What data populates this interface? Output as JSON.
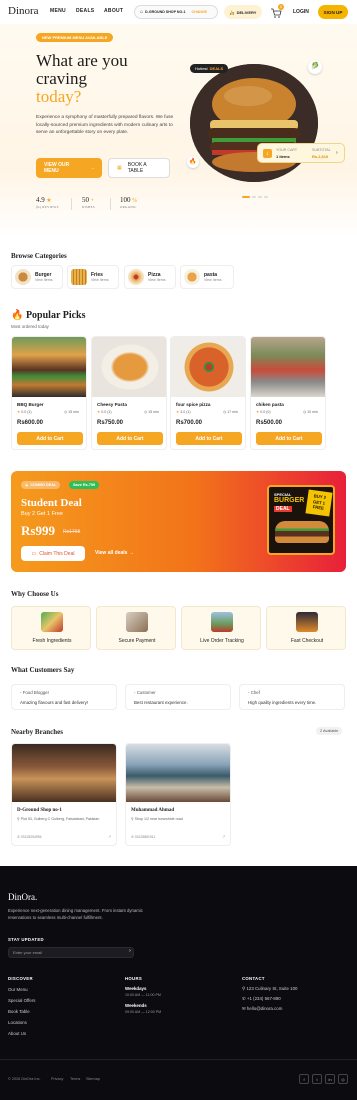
{
  "header": {
    "logo": "Dinora",
    "nav": [
      "MENU",
      "DEALS",
      "ABOUT"
    ],
    "shop": "D-GROUND SHOP NO-1",
    "shop_change": "CHANGE",
    "delivery": "DELIVERY",
    "cart_count": "0",
    "login": "LOGIN",
    "signup": "SIGN UP"
  },
  "hero": {
    "badge": "NEW PREMIUM MENU AVAILABLE",
    "title_line1": "What are you",
    "title_line2": "craving",
    "title_accent": "today?",
    "description": "Experience a symphony of masterfully prepared flavors. We fuse locally-sourced premium ingredients with modern culinary arts to serve an unforgettable story on every plate.",
    "primary_btn": "VIEW OUR MENU",
    "secondary_btn": "BOOK A TABLE",
    "stats": [
      {
        "value": "4.9",
        "label": "(K) REVIEWS"
      },
      {
        "value": "50",
        "label": "DISHES"
      },
      {
        "value": "100",
        "label": "ORGANIC"
      }
    ],
    "hot_tag": "Hottest",
    "hot_tag_accent": "DEALS",
    "cart": {
      "label": "YOUR CART",
      "items": "1 Items",
      "subtotal_label": "SUBTOTAL",
      "subtotal": "Rs.2,610"
    }
  },
  "categories": {
    "title": "Browse Categories",
    "items": [
      {
        "name": "Burger",
        "sub": "View Items"
      },
      {
        "name": "Fries",
        "sub": "View Items"
      },
      {
        "name": "Pizza",
        "sub": "View Items"
      },
      {
        "name": "pasta",
        "sub": "View Items"
      }
    ]
  },
  "popular": {
    "title": "Popular Picks",
    "subtitle": "Most ordered today",
    "add_label": "Add to Cart",
    "items": [
      {
        "name": "BBQ Burger",
        "rating": "0.0 (1)",
        "time": "15 min",
        "price": "Rs600.00"
      },
      {
        "name": "Cheesy Pasta",
        "rating": "0.0 (1)",
        "time": "15 min",
        "price": "Rs750.00"
      },
      {
        "name": "four spice pizza",
        "rating": "3.0 (1)",
        "time": "17 min",
        "price": "Rs700.00"
      },
      {
        "name": "chiken pasta",
        "rating": "0.0 (0)",
        "time": "10 min",
        "price": "Rs500.00"
      }
    ]
  },
  "combo": {
    "tag": "COMBO DEAL",
    "save": "Save Rs.799",
    "title": "Student Deal",
    "subtitle": "Buy 2 Get 1 Free",
    "price": "Rs999",
    "old_price": "Rs1798",
    "claim": "Claim This Deal",
    "view_all": "View all deals",
    "poster_line1": "SPECIAL",
    "poster_line2": "BURGER",
    "poster_line3": "DEAL",
    "poster_buy": "BUY 2",
    "poster_get": "GET 1",
    "poster_free": "FREE"
  },
  "why": {
    "title": "Why Choose Us",
    "items": [
      "Fresh Ingredients",
      "Secure Payment",
      "Live Order Tracking",
      "Fast Checkout"
    ]
  },
  "testimonials": {
    "title": "What Customers Say",
    "items": [
      {
        "role": "Food Blogger",
        "quote": "Amazing flavours and fast delivery!"
      },
      {
        "role": "Customer",
        "quote": "Best restaurant experience."
      },
      {
        "role": "Chef",
        "quote": "High quality ingredients every time."
      }
    ]
  },
  "branches": {
    "title": "Nearby Branches",
    "count": "2 Available",
    "items": [
      {
        "name": "D-Ground Shop no-1",
        "address": "Plot 53, Gulberg C Gulberg, Faisalabad, Pakistan",
        "phone": "03125254994"
      },
      {
        "name": "Muhammad Ahmad",
        "address": "Shop 1/2 near boseshide road",
        "phone": "03125881911"
      }
    ]
  },
  "footer": {
    "logo": "DinOra.",
    "description": "Experience next-generation dining management. From instant dynamic reservations to seamless multi-channel fulfillment.",
    "updated_title": "STAY UPDATED",
    "email_placeholder": "Enter your email",
    "discover_title": "DISCOVER",
    "discover_links": [
      "Our Menu",
      "Special Offers",
      "Book Table",
      "Locations",
      "About Us"
    ],
    "hours_title": "HOURS",
    "weekdays": "Weekdays",
    "weekdays_hours": "10:00 AM — 11:00 PM",
    "weekends": "Weekends",
    "weekends_hours": "09:00 AM — 12:00 PM",
    "contact_title": "CONTACT",
    "address": "123 Culinary St, Suite 100",
    "phone": "+1 (234) 567-890",
    "email": "hello@dinora.com",
    "copyright": "© 2026 DinOra Inc.",
    "bottom_links": [
      "Privacy",
      "Terms",
      "Sitemap"
    ]
  },
  "colors": {
    "accent": "#f5a623",
    "dark": "#0c0b10",
    "signup": "#f5b400"
  }
}
